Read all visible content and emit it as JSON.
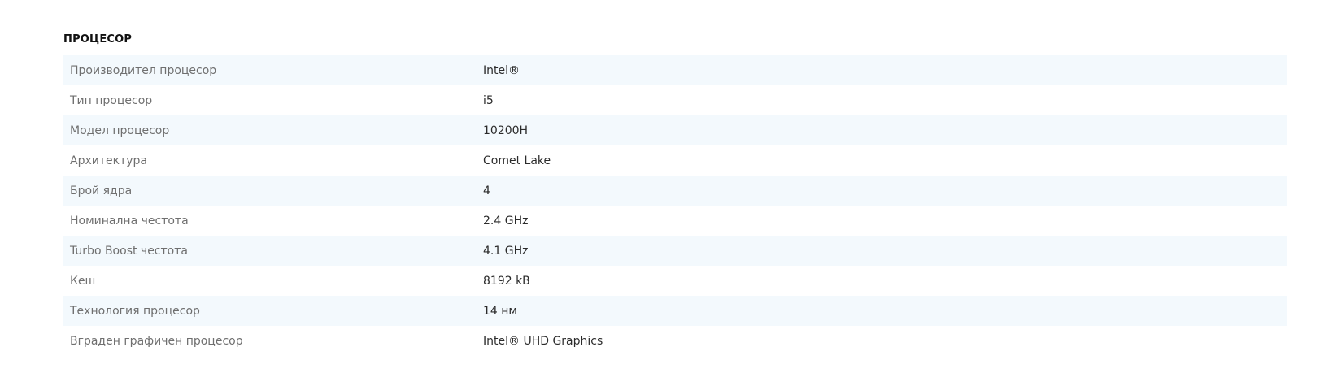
{
  "section": {
    "title": "ПРОЦЕСОР",
    "rows": [
      {
        "label": "Производител процесор",
        "value": "Intel®"
      },
      {
        "label": "Тип процесор",
        "value": "i5"
      },
      {
        "label": "Модел процесор",
        "value": "10200H"
      },
      {
        "label": "Архитектура",
        "value": "Comet Lake"
      },
      {
        "label": "Брой ядра",
        "value": "4"
      },
      {
        "label": "Номинална честота",
        "value": "2.4 GHz"
      },
      {
        "label": "Turbo Boost честота",
        "value": "4.1 GHz"
      },
      {
        "label": "Кеш",
        "value": "8192 kB"
      },
      {
        "label": "Технология процесор",
        "value": "14 нм"
      },
      {
        "label": "Вграден графичен процесор",
        "value": "Intel® UHD Graphics"
      }
    ]
  },
  "colors": {
    "stripe": "#f3f9fd",
    "label_text": "#6f6f6f",
    "value_text": "#2b2b2b",
    "heading": "#111111"
  }
}
